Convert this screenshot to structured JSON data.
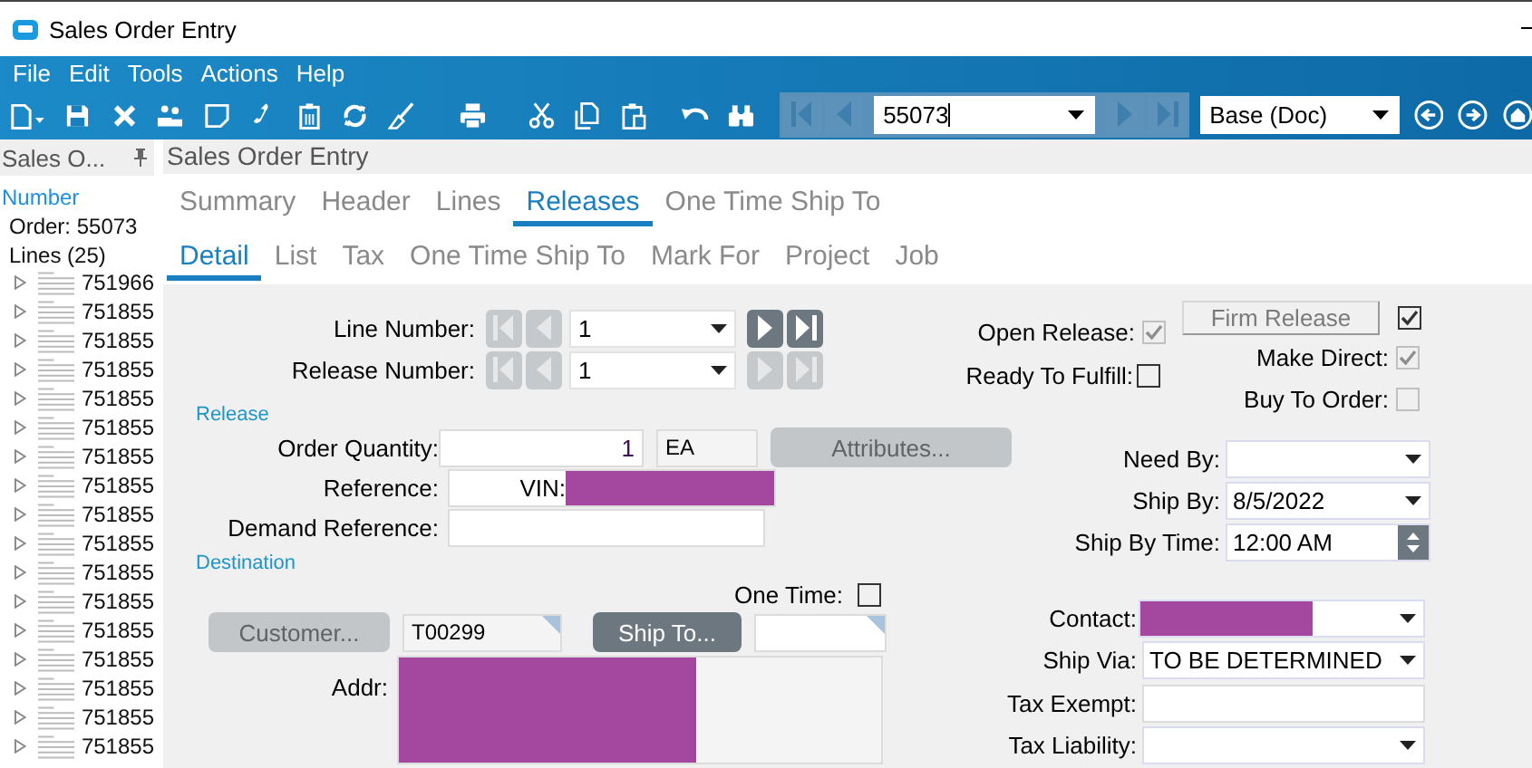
{
  "window": {
    "title": "Sales Order Entry"
  },
  "menu": [
    "File",
    "Edit",
    "Tools",
    "Actions",
    "Help"
  ],
  "toolbar": {
    "record": "55073",
    "layer": "Base (Doc)"
  },
  "sidebar": {
    "title": "Sales O...",
    "heading": "Number",
    "order": "Order: 55073",
    "lines_label": "Lines (25)",
    "items": [
      {
        "label": "751966",
        "expanded": false
      },
      {
        "label": "751855",
        "expanded": false
      },
      {
        "label": "751855",
        "expanded": false
      },
      {
        "label": "751855",
        "expanded": false
      },
      {
        "label": "751855",
        "expanded": false
      },
      {
        "label": "751855",
        "expanded": false
      },
      {
        "label": "751855",
        "expanded": false
      },
      {
        "label": "751855",
        "expanded": false
      },
      {
        "label": "751855",
        "expanded": false
      },
      {
        "label": "751855",
        "expanded": false
      },
      {
        "label": "751855",
        "expanded": false
      },
      {
        "label": "751855",
        "expanded": false
      },
      {
        "label": "751855",
        "expanded": false
      },
      {
        "label": "751855",
        "expanded": false
      },
      {
        "label": "751855",
        "expanded": false
      },
      {
        "label": "751855",
        "expanded": false
      },
      {
        "label": "751855",
        "expanded": false
      }
    ]
  },
  "panel_title": "Sales Order Entry",
  "tabs": [
    {
      "label": "Summary",
      "selected": false
    },
    {
      "label": "Header",
      "selected": false
    },
    {
      "label": "Lines",
      "selected": false
    },
    {
      "label": "Releases",
      "selected": true
    },
    {
      "label": "One Time Ship To",
      "selected": false
    }
  ],
  "subtabs": [
    {
      "label": "Detail",
      "selected": true
    },
    {
      "label": "List",
      "selected": false
    },
    {
      "label": "Tax",
      "selected": false
    },
    {
      "label": "One Time Ship To",
      "selected": false
    },
    {
      "label": "Mark For",
      "selected": false
    },
    {
      "label": "Project",
      "selected": false
    },
    {
      "label": "Job",
      "selected": false
    }
  ],
  "navigators": [
    {
      "label": "Line Number:",
      "value": "1",
      "can_go_back": false,
      "can_go_forward": true
    },
    {
      "label": "Release Number:",
      "value": "1",
      "can_go_back": false,
      "can_go_forward": false
    }
  ],
  "release_flags": [
    {
      "label": "Open Release:",
      "checked": true,
      "disabled": true
    },
    {
      "label": "Ready To Fulfill:",
      "checked": false,
      "disabled": false
    }
  ],
  "firm_release": {
    "label": "Firm Release",
    "disabled": true,
    "checked": true
  },
  "supply_flags": [
    {
      "label": "Make Direct:",
      "checked": true,
      "disabled": true
    },
    {
      "label": "Buy To Order:",
      "checked": false,
      "disabled": true
    }
  ],
  "release_section": {
    "title": "Release",
    "fields": [
      {
        "kind": "quantity",
        "label": "Order Quantity:",
        "value": "1",
        "unit": "EA",
        "button": {
          "label": "Attributes...",
          "disabled": true
        }
      },
      {
        "kind": "text",
        "label": "Reference:",
        "value": "VIN:",
        "redacted": true
      },
      {
        "kind": "text",
        "label": "Demand Reference:"
      }
    ]
  },
  "schedule": [
    {
      "kind": "dropdown",
      "label": "Need By:"
    },
    {
      "kind": "dropdown",
      "label": "Ship By:",
      "value": "8/5/2022"
    },
    {
      "kind": "spinner",
      "label": "Ship By Time:",
      "value": "12:00 AM"
    }
  ],
  "destination": {
    "title": "Destination",
    "one_time": {
      "label": "One Time:",
      "checked": false
    },
    "customer_button": {
      "label": "Customer...",
      "disabled": true
    },
    "customer_id": "T00299",
    "ship_to_button": {
      "label": "Ship To...",
      "disabled": false
    },
    "addr": {
      "label": "Addr:",
      "redacted": true
    },
    "fields": [
      {
        "kind": "dropdown",
        "label": "Contact:",
        "redacted": true
      },
      {
        "kind": "dropdown",
        "label": "Ship Via:",
        "value": "TO BE DETERMINED"
      },
      {
        "kind": "text",
        "label": "Tax Exempt:"
      },
      {
        "kind": "dropdown",
        "label": "Tax Liability:"
      }
    ]
  }
}
